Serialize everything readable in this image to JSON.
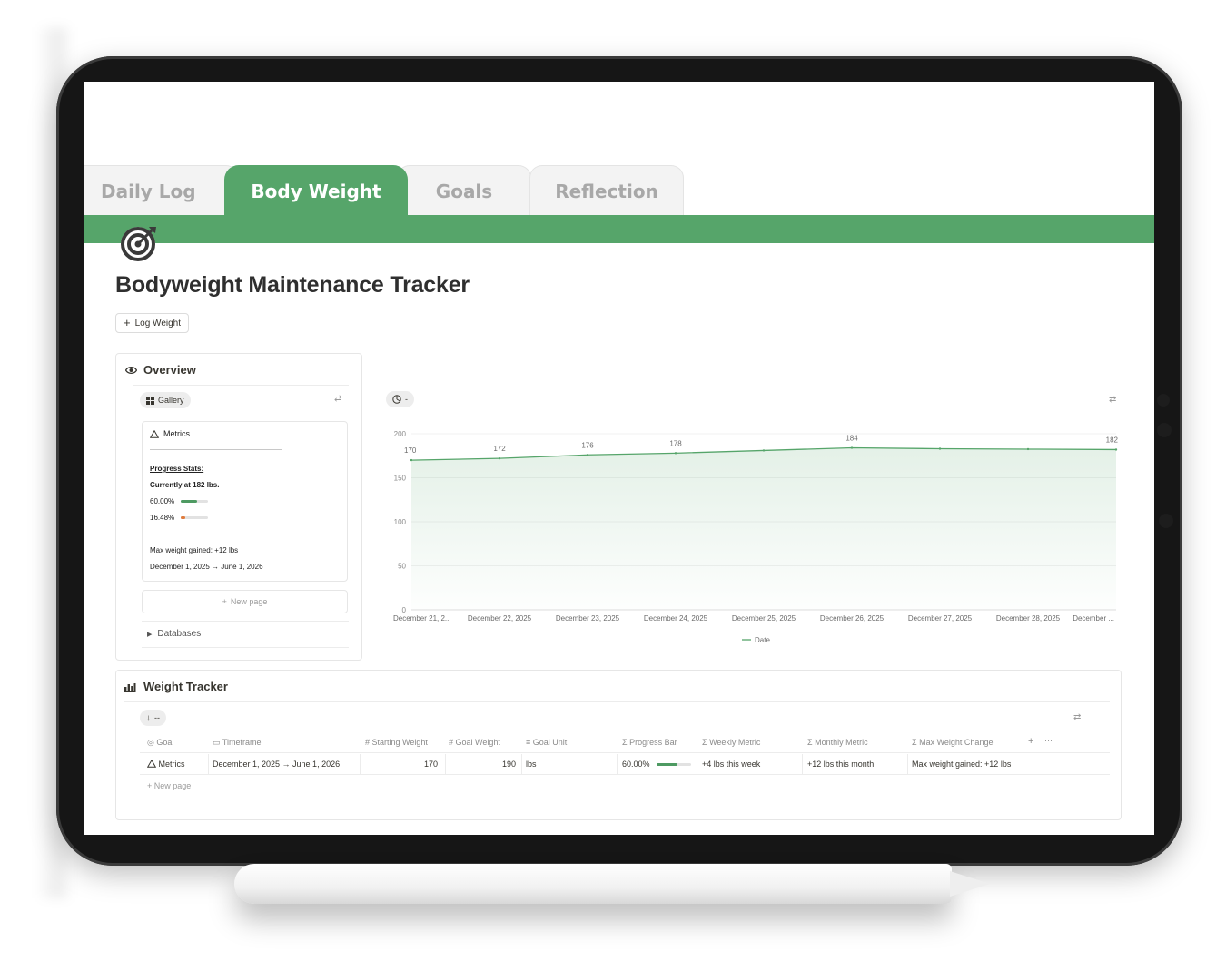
{
  "tabs": [
    {
      "label": "Daily Log",
      "active": false
    },
    {
      "label": "Body Weight",
      "active": true
    },
    {
      "label": "Goals",
      "active": false
    },
    {
      "label": "Reflection",
      "active": false
    }
  ],
  "colors": {
    "accent": "#56a56a",
    "progress_green": "#4e9a62",
    "progress_orange": "#e07b3c"
  },
  "page_icon": "target-icon",
  "page": {
    "title": "Bodyweight Maintenance Tracker",
    "log_button": "Log Weight"
  },
  "overview": {
    "title": "Overview",
    "view_label": "Gallery",
    "card": {
      "title": "Metrics",
      "progress_heading": "Progress Stats:",
      "currently": "Currently at 182 lbs.",
      "pct1": "60.00%",
      "pct1_value": 0.6,
      "pct2": "16.48%",
      "pct2_value": 0.1648,
      "max_gain": "Max weight gained: +12 lbs",
      "timeframe": "December 1, 2025 → June 1, 2026"
    },
    "new_page": "New page",
    "databases": "Databases"
  },
  "chart_toolbar": {
    "label": "-"
  },
  "chart_data": {
    "type": "area",
    "x": [
      "December 21, 2...",
      "December 22, 2025",
      "December 23, 2025",
      "December 24, 2025",
      "December 25, 2025",
      "December 26, 2025",
      "December 27, 2025",
      "December 28, 2025",
      "December ..."
    ],
    "values": [
      170,
      172,
      176,
      178,
      181,
      184,
      183,
      182.5,
      182
    ],
    "point_labels": [
      "170",
      "172",
      "176",
      "178",
      "",
      "184",
      "",
      "",
      "182"
    ],
    "yticks": [
      "0",
      "50",
      "100",
      "150",
      "200"
    ],
    "ylim": [
      0,
      200
    ],
    "legend": "Date",
    "color": "#56a56a"
  },
  "weight_tracker": {
    "title": "Weight Tracker",
    "sort_label": "--",
    "columns": [
      "Goal",
      "Timeframe",
      "Starting Weight",
      "Goal Weight",
      "Goal Unit",
      "Progress Bar",
      "Weekly Metric",
      "Monthly Metric",
      "Max Weight Change"
    ],
    "column_icons": [
      "target-icon",
      "calendar-icon",
      "hash-icon",
      "hash-icon",
      "text-icon",
      "sigma-icon",
      "sigma-icon",
      "sigma-icon",
      "sigma-icon"
    ],
    "row": {
      "goal": "Metrics",
      "timeframe": "December 1, 2025 → June 1, 2026",
      "starting_weight": "170",
      "goal_weight": "190",
      "goal_unit": "lbs",
      "progress": "60.00%",
      "progress_value": 0.6,
      "weekly": "+4 lbs this week",
      "monthly": "+12 lbs this month",
      "max_change": "Max weight gained: +12 lbs"
    },
    "new_page": "New page",
    "add_icon": "+",
    "more_icon": "···"
  }
}
